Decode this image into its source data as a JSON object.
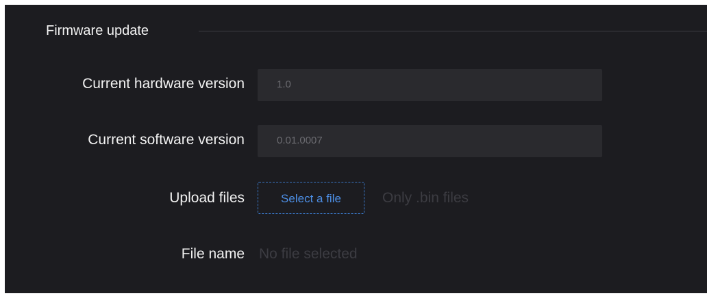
{
  "section": {
    "title": "Firmware update"
  },
  "rows": {
    "hardware": {
      "label": "Current hardware version",
      "value": "1.0"
    },
    "software": {
      "label": "Current software version",
      "value": "0.01.0007"
    },
    "upload": {
      "label": "Upload files",
      "button_label": "Select a file",
      "hint": "Only .bin files"
    },
    "file_name": {
      "label": "File name",
      "value": "No file selected"
    }
  },
  "colors": {
    "panel_background": "#1c1c20",
    "field_background": "#2a2a2e",
    "accent": "#4d8fe6",
    "label_text": "#f2f2f2",
    "muted_text": "#3c3c42"
  }
}
